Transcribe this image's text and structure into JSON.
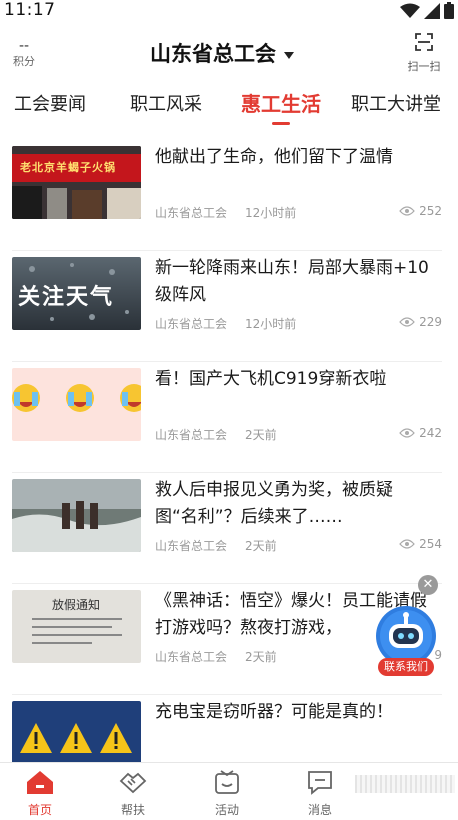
{
  "status_bar": {
    "time": "11:17"
  },
  "header": {
    "points_value": "--",
    "points_label": "积分",
    "title": "山东省总工会",
    "scan_label": "扫一扫"
  },
  "tabs": [
    {
      "label": "工会要闻"
    },
    {
      "label": "职工风采"
    },
    {
      "label": "惠工生活"
    },
    {
      "label": "职工大讲堂"
    }
  ],
  "feed": [
    {
      "title": "他献出了生命，他们留下了温情",
      "source": "山东省总工会",
      "time": "12小时前",
      "views": "252",
      "thumb_text": "老北京羊蝎子火锅"
    },
    {
      "title": "新一轮降雨来山东！局部大暴雨+10级阵风",
      "source": "山东省总工会",
      "time": "12小时前",
      "views": "229",
      "thumb_text": "关注天气"
    },
    {
      "title": "看！国产大飞机C919穿新衣啦",
      "source": "山东省总工会",
      "time": "2天前",
      "views": "242"
    },
    {
      "title": "救人后申报见义勇为奖，被质疑图“名利”？后续来了……",
      "source": "山东省总工会",
      "time": "2天前",
      "views": "254"
    },
    {
      "title": "《黑神话：悟空》爆火！员工能请假打游戏吗？熬夜打游戏，",
      "source": "山东省总工会",
      "time": "2天前",
      "views": "9",
      "thumb_text": "放假通知"
    },
    {
      "title": "充电宝是窃听器？可能是真的！",
      "source": "山东省总工会",
      "time": "",
      "views": ""
    }
  ],
  "fab": {
    "label": "联系我们"
  },
  "bottom_nav": [
    {
      "label": "首页"
    },
    {
      "label": "帮扶"
    },
    {
      "label": "活动"
    },
    {
      "label": "消息"
    }
  ],
  "colors": {
    "accent": "#e23b32",
    "robot": "#2f7de0"
  }
}
